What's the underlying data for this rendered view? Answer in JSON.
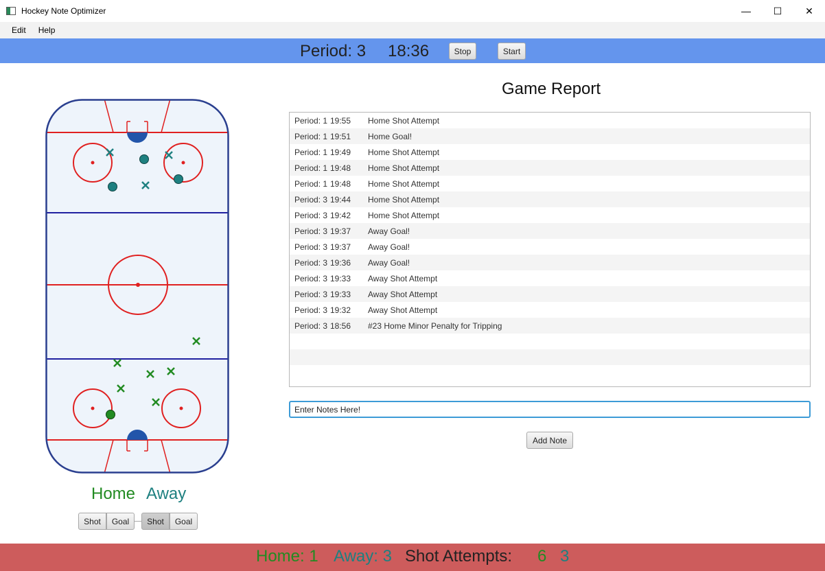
{
  "window": {
    "title": "Hockey Note Optimizer",
    "minimize": "—",
    "maximize": "☐",
    "close": "✕"
  },
  "menu": {
    "edit": "Edit",
    "help": "Help"
  },
  "header": {
    "period_label": "Period: 3",
    "clock": "18:36",
    "stop_label": "Stop",
    "start_label": "Start",
    "bar_color": "#6495ed"
  },
  "rink": {
    "home_color": "#228b22",
    "away_color": "#1e8080",
    "line_red": "#e02020",
    "line_blue": "#2020a0",
    "ice": "#eef4fb",
    "crease": "#2255aa"
  },
  "teams": {
    "home_label": "Home",
    "away_label": "Away"
  },
  "team_buttons": {
    "home_shot": "Shot",
    "home_goal": "Goal",
    "away_shot": "Shot",
    "away_goal": "Goal"
  },
  "report": {
    "title": "Game Report",
    "rows": [
      {
        "period": "Period: 1",
        "time": "19:55",
        "desc": "Home Shot Attempt"
      },
      {
        "period": "Period: 1",
        "time": "19:51",
        "desc": "Home Goal!"
      },
      {
        "period": "Period: 1",
        "time": "19:49",
        "desc": "Home Shot Attempt"
      },
      {
        "period": "Period: 1",
        "time": "19:48",
        "desc": "Home Shot Attempt"
      },
      {
        "period": "Period: 1",
        "time": "19:48",
        "desc": "Home Shot Attempt"
      },
      {
        "period": "Period: 3",
        "time": "19:44",
        "desc": "Home Shot Attempt"
      },
      {
        "period": "Period: 3",
        "time": "19:42",
        "desc": "Home Shot Attempt"
      },
      {
        "period": "Period: 3",
        "time": "19:37",
        "desc": "Away Goal!"
      },
      {
        "period": "Period: 3",
        "time": "19:37",
        "desc": "Away Goal!"
      },
      {
        "period": "Period: 3",
        "time": "19:36",
        "desc": "Away Goal!"
      },
      {
        "period": "Period: 3",
        "time": "19:33",
        "desc": "Away Shot Attempt"
      },
      {
        "period": "Period: 3",
        "time": "19:33",
        "desc": "Away Shot Attempt"
      },
      {
        "period": "Period: 3",
        "time": "19:32",
        "desc": "Away Shot Attempt"
      },
      {
        "period": "Period: 3",
        "time": "18:56",
        "desc": "#23 Home Minor Penalty for Tripping"
      },
      {
        "period": "",
        "time": "",
        "desc": ""
      },
      {
        "period": "",
        "time": "",
        "desc": ""
      },
      {
        "period": "",
        "time": "",
        "desc": ""
      }
    ]
  },
  "notes": {
    "value": "Enter Notes Here!",
    "add_label": "Add Note"
  },
  "footer": {
    "home": "Home: 1",
    "away": "Away: 3",
    "shots_label": "Shot Attempts:",
    "home_shots": "6",
    "away_shots": "3",
    "bar_color": "#cd5c5c"
  }
}
